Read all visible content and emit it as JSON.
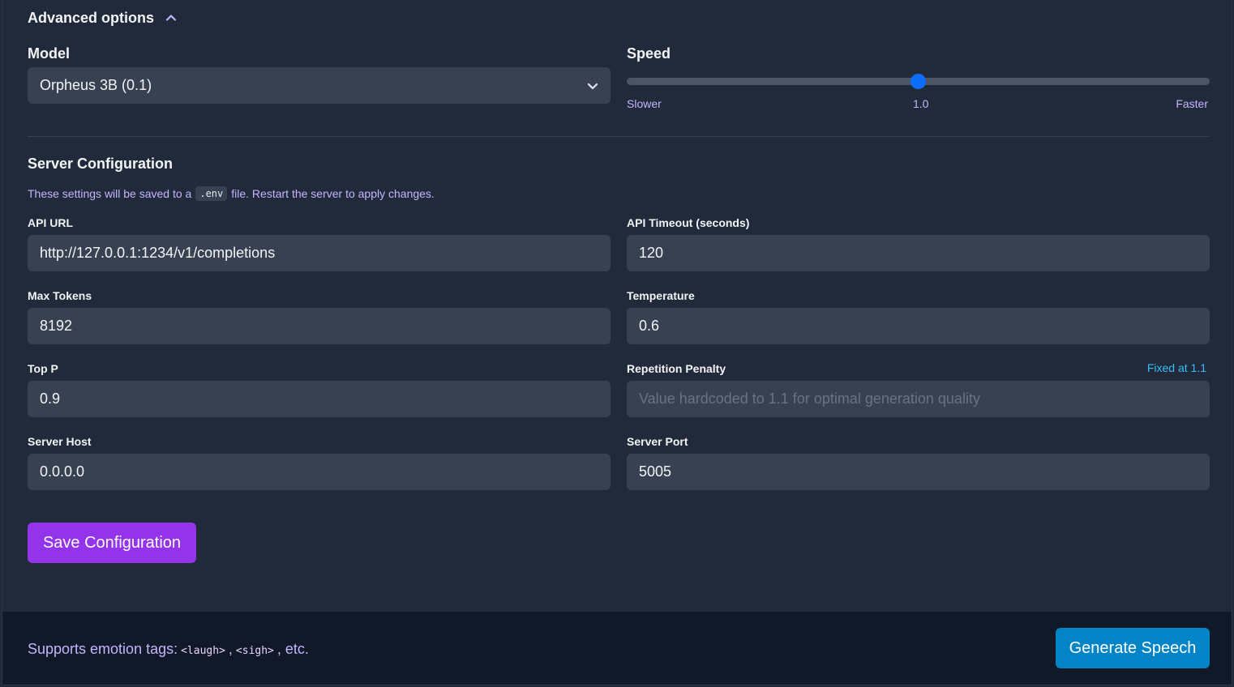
{
  "advanced": {
    "title": "Advanced options",
    "toggle_icon": "chevron-up-icon"
  },
  "model": {
    "label": "Model",
    "selected": "Orpheus 3B (0.1)",
    "icon": "chevron-down-icon"
  },
  "speed": {
    "label": "Speed",
    "min_label": "Slower",
    "value_label": "1.0",
    "max_label": "Faster",
    "value_fraction": 0.5,
    "accent": "#0d6efd"
  },
  "server_config": {
    "title": "Server Configuration",
    "desc_before": "These settings will be saved to a",
    "desc_code": ".env",
    "desc_after": "file. Restart the server to apply changes.",
    "fields": {
      "api_url": {
        "label": "API URL",
        "value": "http://127.0.0.1:1234/v1/completions"
      },
      "api_timeout": {
        "label": "API Timeout (seconds)",
        "value": "120"
      },
      "max_tokens": {
        "label": "Max Tokens",
        "value": "8192"
      },
      "temperature": {
        "label": "Temperature",
        "value": "0.6"
      },
      "top_p": {
        "label": "Top P",
        "value": "0.9"
      },
      "repetition_penalty": {
        "label": "Repetition Penalty",
        "note": "Fixed at 1.1",
        "placeholder": "Value hardcoded to 1.1 for optimal generation quality"
      },
      "server_host": {
        "label": "Server Host",
        "value": "0.0.0.0"
      },
      "server_port": {
        "label": "Server Port",
        "value": "5005"
      }
    },
    "save_label": "Save Configuration",
    "save_color": "#9333ea"
  },
  "footer": {
    "text_prefix": "Supports emotion tags:",
    "tag1": "<laugh>",
    "sep": ",",
    "tag2": "<sigh>",
    "text_suffix": ", etc.",
    "generate_label": "Generate Speech",
    "generate_color": "#0284c7"
  }
}
